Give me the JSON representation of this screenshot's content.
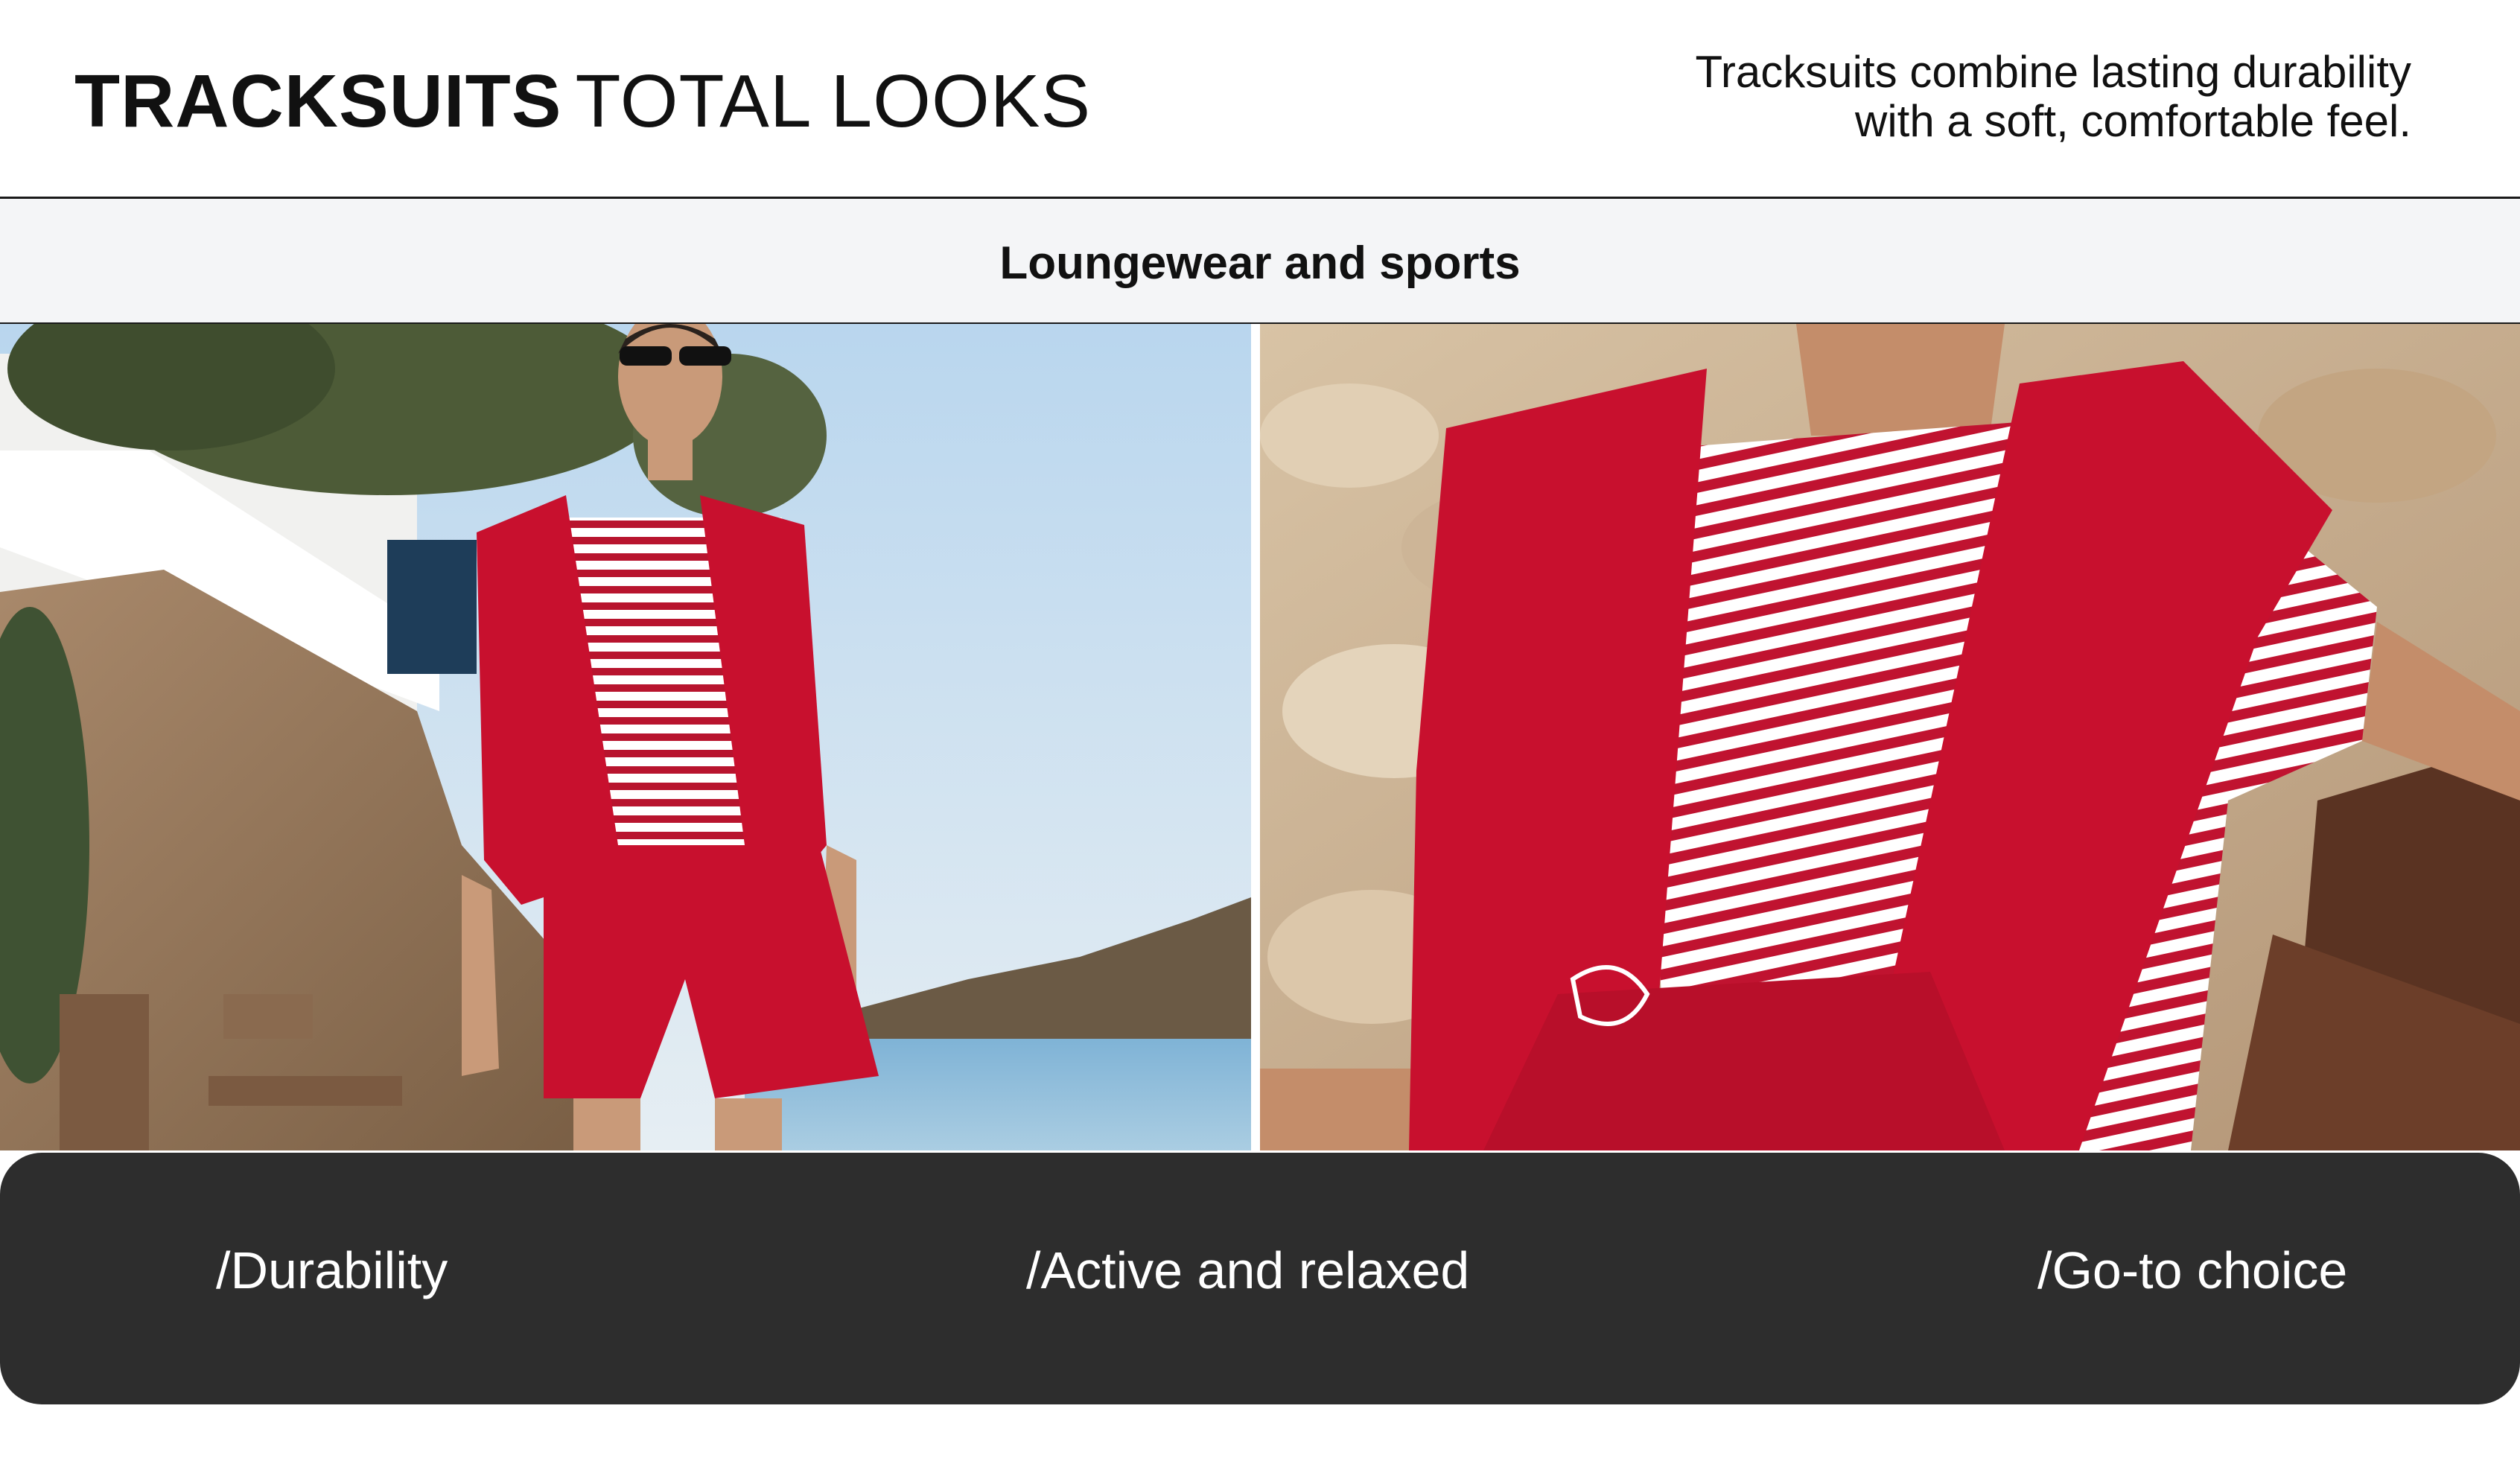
{
  "header": {
    "title_bold": "TRACKSUITS",
    "title_light": "TOTAL LOOKS",
    "tagline_line1": "Tracksuits combine lasting durability",
    "tagline_line2": "with a soft, comfortable feel."
  },
  "band": {
    "label": "Loungewear and sports"
  },
  "photos": {
    "left": "model walking seaside in red tracksuit",
    "right": "close-up of red striped top and red jacket over shoulders"
  },
  "features": [
    {
      "label": "/Durability"
    },
    {
      "label": "/Active and relaxed"
    },
    {
      "label": "/Go-to choice"
    }
  ],
  "colors": {
    "panel": "#2d2d2d",
    "band": "#f4f5f7",
    "accent_red": "#c8102e"
  }
}
